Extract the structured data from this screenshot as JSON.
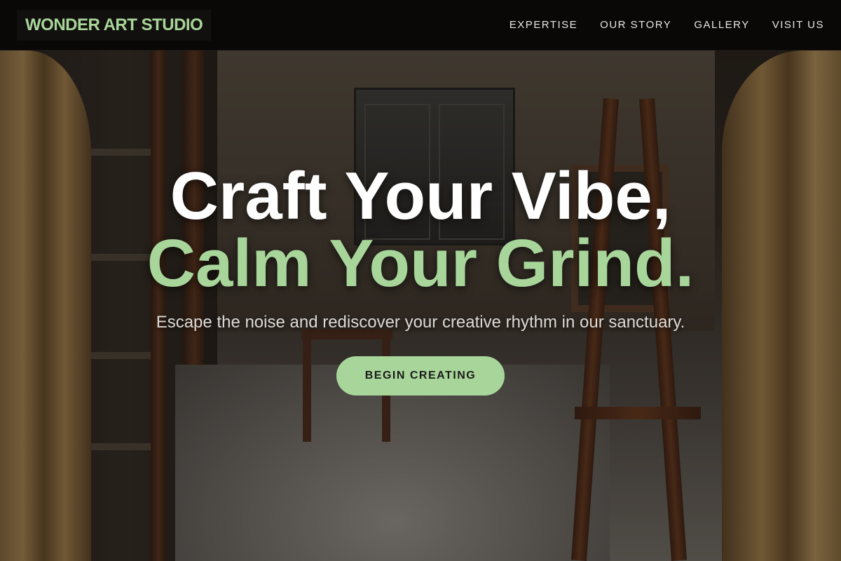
{
  "brand": {
    "name": "WONDER ART STUDIO"
  },
  "nav": {
    "items": [
      {
        "label": "EXPERTISE"
      },
      {
        "label": "OUR STORY"
      },
      {
        "label": "GALLERY"
      },
      {
        "label": "VISIT US"
      }
    ]
  },
  "hero": {
    "headline_line1": "Craft Your Vibe,",
    "headline_line2": "Calm Your Grind.",
    "subtitle": "Escape the noise and rediscover your creative rhythm in our sanctuary.",
    "cta_label": "BEGIN CREATING"
  },
  "colors": {
    "accent": "#a8d69a",
    "navbar_bg": "#080706",
    "headline": "#ffffff",
    "cta_text": "#1b1b1b"
  },
  "background": {
    "image": "art-studio-interior-photo"
  }
}
